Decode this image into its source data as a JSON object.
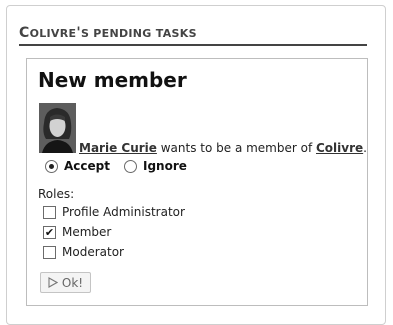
{
  "section": {
    "title_first": "C",
    "title_rest_a": "OLIVRE",
    "title_apos": "'",
    "title_rest_b": "S PENDING TASKS"
  },
  "task": {
    "title": "New member",
    "person_name": "Marie Curie",
    "request_text": " wants to be a member of ",
    "community_name": "Colivre",
    "period": ".",
    "options": {
      "accept": "Accept",
      "ignore": "Ignore",
      "selected": "accept"
    },
    "roles_label": "Roles:",
    "roles": [
      {
        "label": "Profile Administrator",
        "checked": false
      },
      {
        "label": "Member",
        "checked": true
      },
      {
        "label": "Moderator",
        "checked": false
      }
    ],
    "ok_label": "Ok!"
  },
  "icons": {
    "ok": "play-triangle-icon",
    "accept": "radio-selected-icon",
    "ignore": "radio-unselected-icon"
  }
}
